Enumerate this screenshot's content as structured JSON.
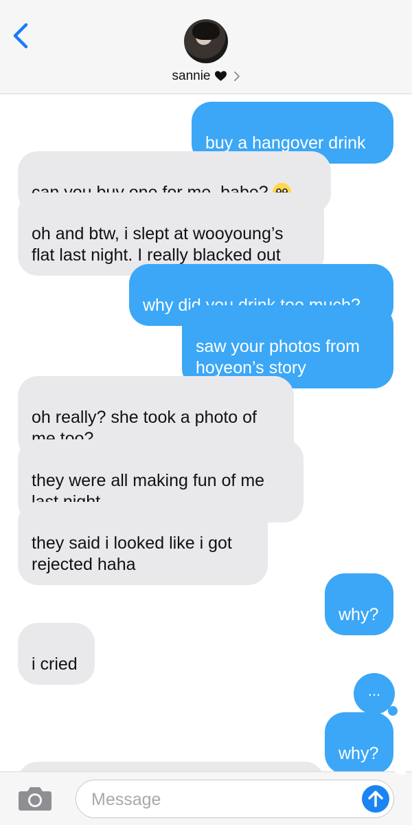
{
  "header": {
    "contact_name": "sannie",
    "back_icon": "chevron-left-icon",
    "heart_icon": "heart-icon",
    "chevron_icon": "chevron-right-icon",
    "accent": "#1a7cf5"
  },
  "messages": [
    {
      "side": "sent",
      "text": "buy a hangover drink"
    },
    {
      "side": "recv",
      "text": "can you buy one for me, babe?",
      "emoji": "pleading-face"
    },
    {
      "side": "recv",
      "text": "oh and btw, i slept at wooyoung’s flat last night. I really blacked out"
    },
    {
      "side": "sent",
      "text": "why did you drink too much?"
    },
    {
      "side": "sent",
      "text": "saw your photos from hoyeon’s story"
    },
    {
      "side": "recv",
      "text": "oh really? she took a photo of me too?"
    },
    {
      "side": "recv",
      "text": "they were all making fun of me last night"
    },
    {
      "side": "recv",
      "text": "they said i looked like i got rejected haha"
    },
    {
      "side": "sent",
      "text": "why?"
    },
    {
      "side": "recv",
      "text": "i cried"
    },
    {
      "side": "sent",
      "text": "..."
    },
    {
      "side": "sent",
      "text": "why?"
    }
  ],
  "colors": {
    "sent_bubble": "#3ba7f6",
    "recv_bubble": "#e9e9ec"
  },
  "input": {
    "placeholder": "Message",
    "camera_icon": "camera-icon",
    "send_icon": "arrow-up-icon"
  }
}
